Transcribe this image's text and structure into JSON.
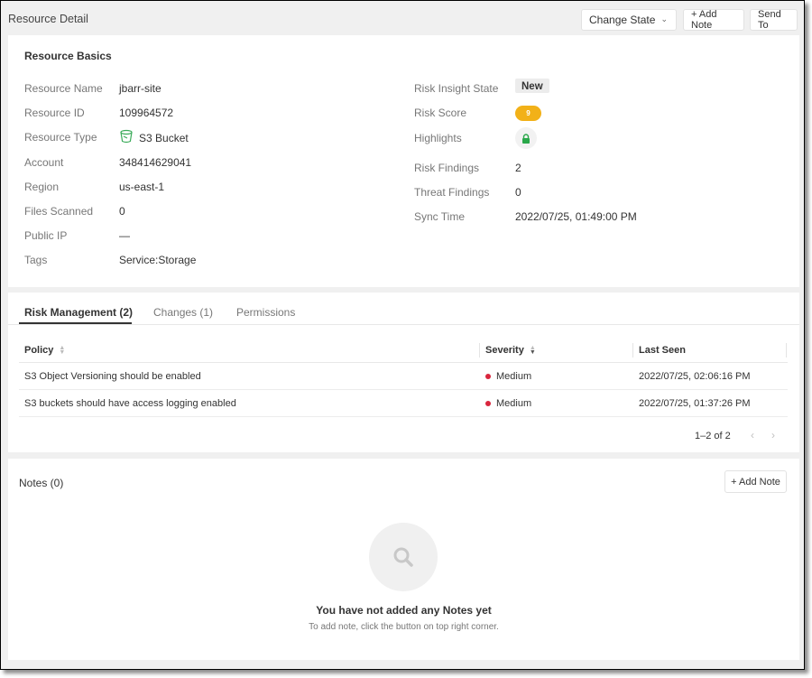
{
  "header": {
    "title": "Resource Detail",
    "change_state_label": "Change State",
    "add_note_label": "+ Add Note",
    "send_to_label": "Send To"
  },
  "basics": {
    "title": "Resource Basics",
    "left": [
      {
        "label": "Resource Name",
        "value": "jbarr-site"
      },
      {
        "label": "Resource ID",
        "value": "109964572"
      },
      {
        "label": "Resource Type",
        "value": "S3 Bucket",
        "icon": "s3-bucket-icon"
      },
      {
        "label": "Account",
        "value": "348414629041"
      },
      {
        "label": "Region",
        "value": "us-east-1"
      },
      {
        "label": "Files Scanned",
        "value": "0"
      },
      {
        "label": "Public IP",
        "value": "—"
      },
      {
        "label": "Tags",
        "value": "Service:Storage"
      }
    ],
    "right": {
      "risk_insight_state": {
        "label": "Risk Insight State",
        "value": "New"
      },
      "risk_score": {
        "label": "Risk Score",
        "value": "9",
        "color": "#f2b118"
      },
      "highlights": {
        "label": "Highlights",
        "icon": "lock-icon",
        "color": "#2aa84a"
      },
      "risk_findings": {
        "label": "Risk Findings",
        "value": "2",
        "color": "#2a6fb5"
      },
      "threat_findings": {
        "label": "Threat Findings",
        "value": "0"
      },
      "sync_time": {
        "label": "Sync Time",
        "value": "2022/07/25, 01:49:00 PM"
      }
    }
  },
  "tabs": [
    {
      "label": "Risk Management (2)",
      "active": true
    },
    {
      "label": "Changes (1)",
      "active": false
    },
    {
      "label": "Permissions",
      "active": false
    }
  ],
  "table": {
    "columns": [
      "Policy",
      "Severity",
      "Last Seen"
    ],
    "rows": [
      {
        "policy": "S3 Object Versioning should be enabled",
        "severity": "Medium",
        "last_seen": "2022/07/25, 02:06:16 PM"
      },
      {
        "policy": "S3 buckets should have access logging enabled",
        "severity": "Medium",
        "last_seen": "2022/07/25, 01:37:26 PM"
      }
    ],
    "severity_color": "#d9263d",
    "pagination": "1–2 of 2"
  },
  "notes": {
    "title": "Notes (0)",
    "add_note_label": "+ Add Note",
    "empty_title": "You have not added any Notes yet",
    "empty_subtitle": "To add note, click the button on top right corner."
  }
}
